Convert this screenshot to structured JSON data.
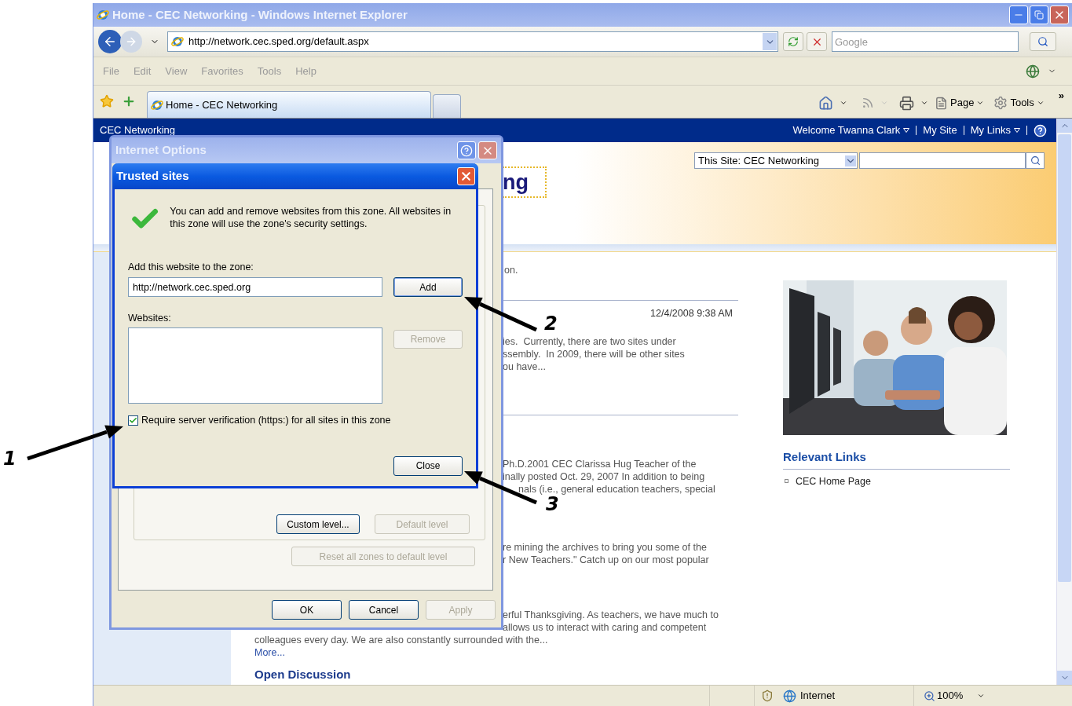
{
  "window": {
    "title": "Home - CEC Networking - Windows Internet Explorer"
  },
  "address_bar": {
    "url": "http://network.cec.sped.org/default.aspx"
  },
  "search_box": {
    "placeholder": "Google"
  },
  "menu": [
    "File",
    "Edit",
    "View",
    "Favorites",
    "Tools",
    "Help"
  ],
  "tabs": [
    {
      "label": "Home - CEC Networking",
      "selected": true
    }
  ],
  "command_bar": [
    "Page",
    "Tools"
  ],
  "toolbar_overflow": "»",
  "page": {
    "site_name": "CEC Networking",
    "user_links": [
      {
        "label": "Welcome Twanna Clark",
        "dropdown": true
      },
      {
        "label": "My Site",
        "dropdown": false
      },
      {
        "label": "My Links",
        "dropdown": true
      }
    ],
    "scope_select": "This Site: CEC Networking",
    "site_title_fragment": "ng",
    "intro_fragment": "on.",
    "posts": [
      {
        "date": "12/4/2008 9:38 AM",
        "lines": [
          "ies.  Currently, there are two sites under",
          "ssembly.  In 2009, there will be other sites",
          "ou have..."
        ]
      },
      {
        "lines": [
          "Ph.D.2001 CEC Clarissa Hug Teacher of the",
          "inally posted Oct. 29, 2007 In addition to being",
          "nals (i.e., general education teachers, special"
        ]
      },
      {
        "lines": [
          "re mining the archives to bring you some of the",
          "r New Teachers.\" Catch up on our most popular"
        ]
      },
      {
        "lines": [
          "erful Thanksgiving. As teachers, we have much to",
          "allows us to interact with caring and competent"
        ],
        "continuation": "colleagues every day. We are also constantly surrounded with the...",
        "more_link": "More..."
      }
    ],
    "section_heading": "Open Discussion",
    "relevant_links": {
      "title": "Relevant Links",
      "items": [
        "CEC Home Page"
      ]
    }
  },
  "status_bar": {
    "zone": "Internet",
    "zoom": "100%"
  },
  "internet_options": {
    "title": "Internet Options",
    "zone_buttons": [
      {
        "label": "Custom level...",
        "disabled": false
      },
      {
        "label": "Default level",
        "disabled": true
      }
    ],
    "reset_button": {
      "label": "Reset all zones to default level",
      "disabled": true
    },
    "footer_buttons": [
      {
        "label": "OK",
        "disabled": false
      },
      {
        "label": "Cancel",
        "disabled": false
      },
      {
        "label": "Apply",
        "disabled": true
      }
    ]
  },
  "trusted_sites": {
    "title": "Trusted sites",
    "message": "You can add and remove websites from this zone. All websites in this zone will use the zone's security settings.",
    "add_label": "Add this website to the zone:",
    "url_value": "http://network.cec.sped.org",
    "add_button": "Add",
    "websites_label": "Websites:",
    "remove_button": {
      "label": "Remove",
      "disabled": true
    },
    "require_https": {
      "label": "Require server verification (https:) for all sites in this zone",
      "checked": true
    },
    "close_button": "Close"
  },
  "callouts": [
    {
      "label": "1"
    },
    {
      "label": "2"
    },
    {
      "label": "3"
    }
  ]
}
